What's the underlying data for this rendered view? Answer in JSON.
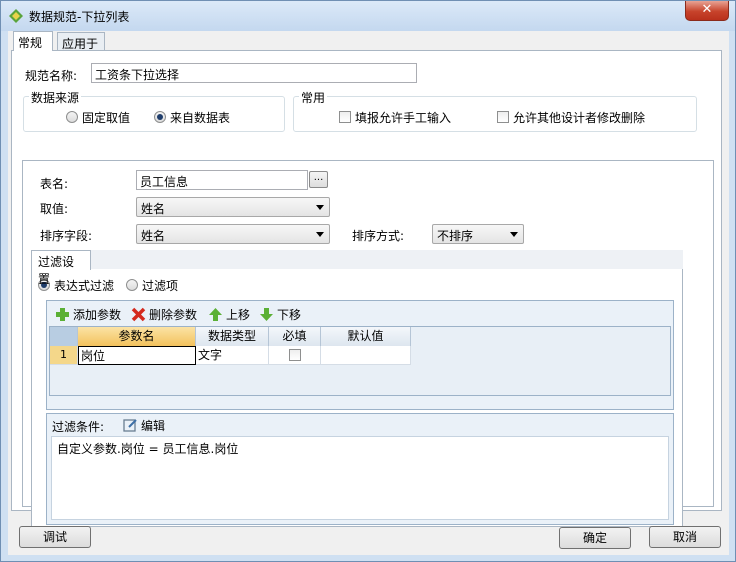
{
  "window": {
    "title": "数据规范-下拉列表",
    "close_label": "✕"
  },
  "tabs": [
    "常规",
    "应用于"
  ],
  "spec": {
    "name_label": "规范名称:",
    "name_value": "工资条下拉选择"
  },
  "data_source": {
    "title": "数据来源",
    "options": [
      "固定取值",
      "来自数据表"
    ],
    "selected": "来自数据表"
  },
  "common": {
    "title": "常用",
    "options": [
      {
        "label": "填报允许手工输入",
        "checked": false
      },
      {
        "label": "允许其他设计者修改删除",
        "checked": false
      }
    ]
  },
  "table": {
    "table_label": "表名:",
    "table_value": "员工信息",
    "browse_label": "...",
    "value_label": "取值:",
    "value_value": "姓名",
    "sort_field_label": "排序字段:",
    "sort_field_value": "姓名",
    "sort_mode_label": "排序方式:",
    "sort_mode_value": "不排序"
  },
  "filter": {
    "tab_label": "过滤设置",
    "modes": [
      "表达式过滤",
      "过滤项"
    ],
    "selected_mode": "表达式过滤",
    "toolbar": {
      "add": "添加参数",
      "delete": "删除参数",
      "up": "上移",
      "down": "下移"
    },
    "columns": [
      "参数名",
      "数据类型",
      "必填",
      "默认值"
    ],
    "rows": [
      {
        "num": "1",
        "name": "岗位",
        "type": "文字",
        "required": false,
        "default": ""
      }
    ],
    "condition_label": "过滤条件:",
    "edit_label": "编辑",
    "condition_text": "自定义参数.岗位 = 员工信息.岗位"
  },
  "buttons": {
    "debug": "调试",
    "ok": "确定",
    "cancel": "取消"
  },
  "colors": {
    "accent": "#1f3d6b",
    "title_bar": "#cfe0f2",
    "close": "#c7432b"
  }
}
